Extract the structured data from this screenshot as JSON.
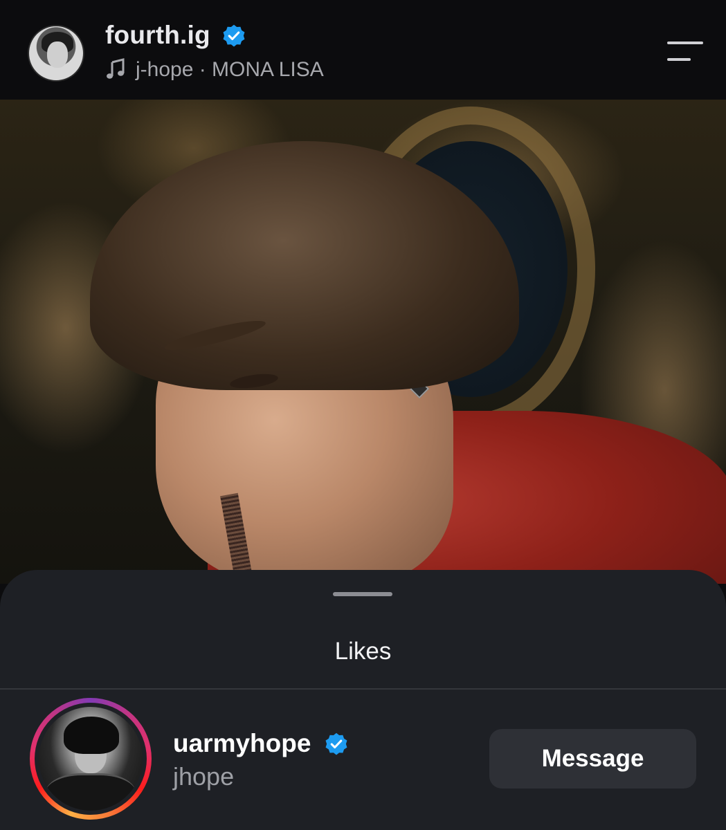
{
  "header": {
    "username": "fourth.ig",
    "verified": true,
    "music": {
      "icon": "music-note-icon",
      "text": "j-hope · MONA LISA"
    },
    "menu_icon": "menu-icon"
  },
  "sheet": {
    "title": "Likes",
    "likes": [
      {
        "username": "uarmyhope",
        "verified": true,
        "full_name": "jhope",
        "has_story_ring": true,
        "action_label": "Message"
      }
    ]
  },
  "colors": {
    "background": "#0c0c0e",
    "sheet": "#1e2025",
    "verified_blue": "#1d9bf0",
    "button": "#2e3036",
    "secondary_text": "#9ea0a6"
  }
}
